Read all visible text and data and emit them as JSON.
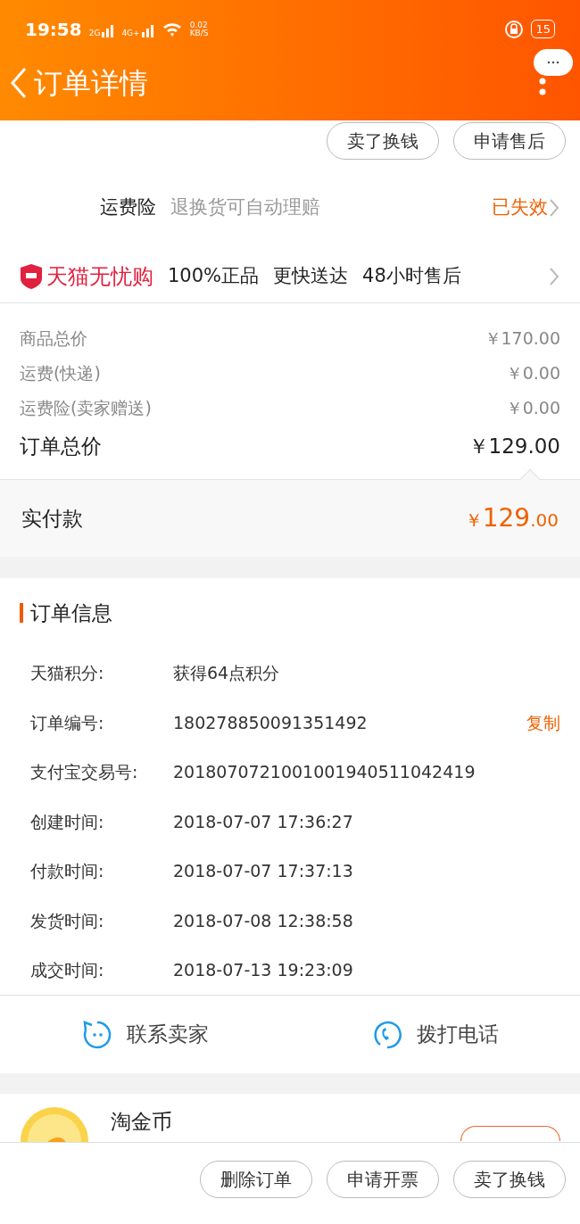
{
  "status_bar": {
    "time": "19:58",
    "network_1": "2G",
    "network_2": "4G+",
    "speed": "0.02",
    "speed_unit": "KB/S",
    "battery": "15"
  },
  "header": {
    "title": "订单详情"
  },
  "top_actions": [
    "卖了换钱",
    "申请售后"
  ],
  "shipping_insurance": {
    "label": "运费险",
    "description": "退换货可自动理赔",
    "status": "已失效"
  },
  "tmall_guarantee": {
    "brand": "天猫无忧购",
    "features": [
      "100%正品",
      "更快送达",
      "48小时售后"
    ]
  },
  "price_rows": [
    {
      "label": "商品总价",
      "value": "￥170.00",
      "kind": "minor"
    },
    {
      "label": "运费(快递)",
      "value": "￥0.00",
      "kind": "minor"
    },
    {
      "label": "运费险(卖家赠送)",
      "value": "￥0.00",
      "kind": "minor"
    },
    {
      "label": "订单总价",
      "value": "￥129.00",
      "kind": "total"
    }
  ],
  "paid": {
    "label": "实付款",
    "currency": "￥",
    "integer": "129",
    "decimal": ".00"
  },
  "order_info": {
    "title": "订单信息",
    "rows": [
      {
        "label": "天猫积分:",
        "value": "获得64点积分"
      },
      {
        "label": "订单编号:",
        "value": "180278850091351492",
        "action": "复制"
      },
      {
        "label": "支付宝交易号:",
        "value": "2018070721001001940511042419"
      },
      {
        "label": "创建时间:",
        "value": "2018-07-07 17:36:27"
      },
      {
        "label": "付款时间:",
        "value": "2018-07-07 17:37:13"
      },
      {
        "label": "发货时间:",
        "value": "2018-07-08 12:38:58"
      },
      {
        "label": "成交时间:",
        "value": "2018-07-13 19:23:09"
      }
    ]
  },
  "contact": [
    {
      "label": "联系卖家",
      "kind": "chat"
    },
    {
      "label": "拨打电话",
      "kind": "phone"
    }
  ],
  "coins": {
    "title": "淘金币"
  },
  "bottom_actions": [
    "删除订单",
    "申请开票",
    "卖了换钱"
  ]
}
